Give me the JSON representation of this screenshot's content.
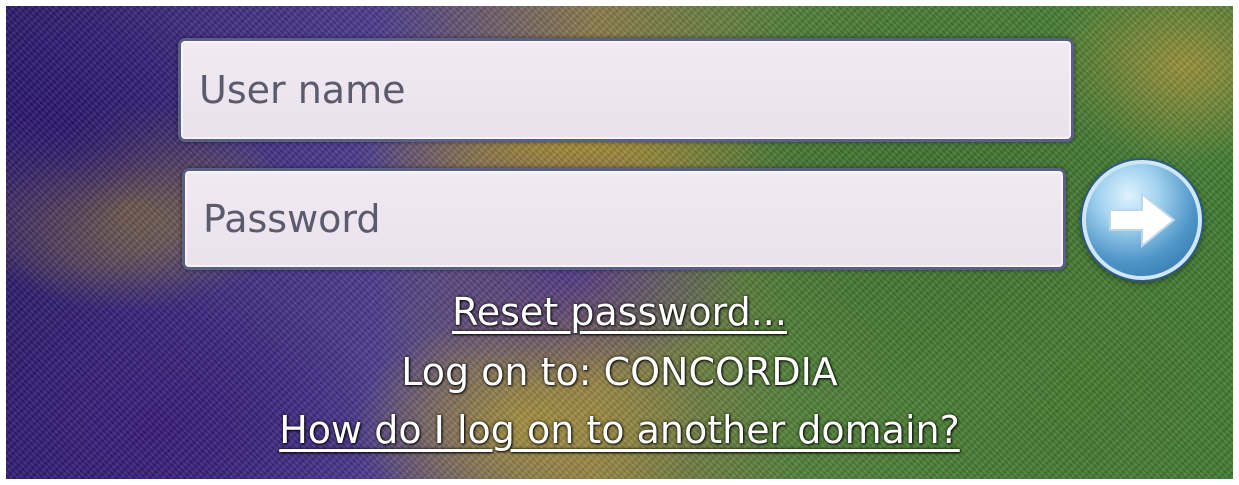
{
  "login": {
    "username_placeholder": "User name",
    "password_placeholder": "Password",
    "submit_icon": "arrow-right-icon",
    "reset_password_link": "Reset password...",
    "log_on_to_text": "Log on to: CONCORDIA",
    "another_domain_link": "How do I log on to another domain?"
  },
  "colors": {
    "field_background": "#ece4ee",
    "field_border": "#5a5f86",
    "button_blue": "#4f96c8",
    "link_text": "#ffffff"
  }
}
